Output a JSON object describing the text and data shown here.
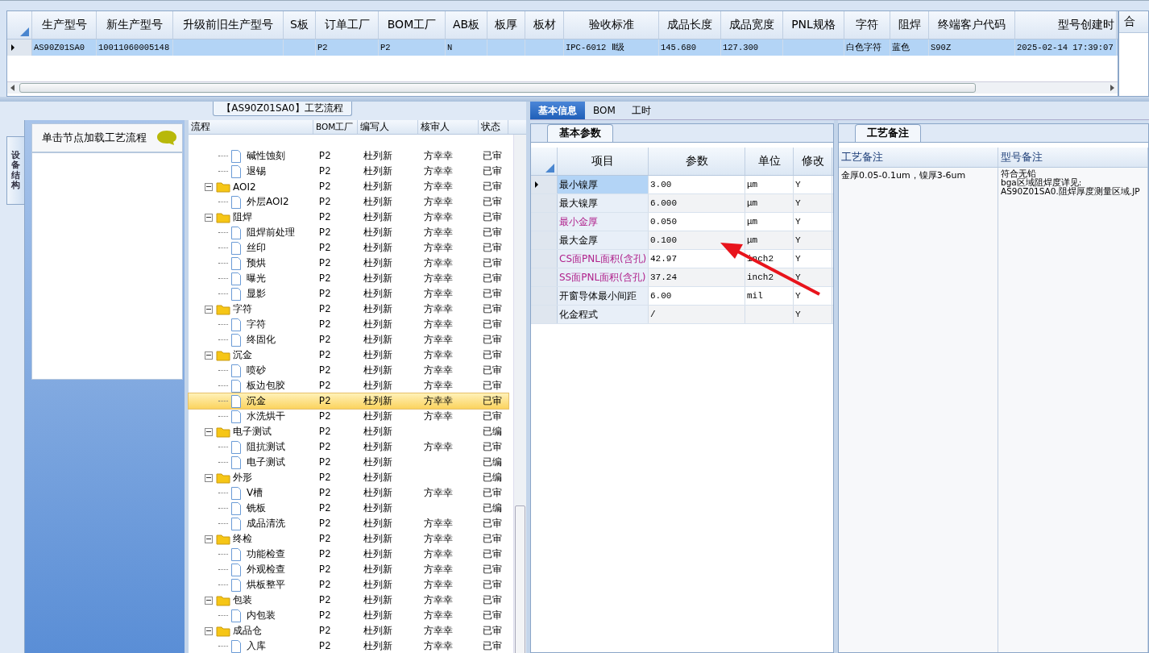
{
  "main_grid": {
    "columns": [
      "生产型号",
      "新生产型号",
      "升级前旧生产型号",
      "S板",
      "订单工厂",
      "BOM工厂",
      "AB板",
      "板厚",
      "板材",
      "验收标准",
      "成品长度",
      "成品宽度",
      "PNL规格",
      "字符",
      "阻焊",
      "终端客户代码",
      "型号创建时"
    ],
    "rows": [
      {
        "selected": true,
        "cells": [
          "AS90Z01SA0",
          "10011060005148",
          null,
          null,
          "P2",
          "P2",
          "N",
          null,
          null,
          "IPC-6012 Ⅱ级",
          "145.680",
          "127.300",
          null,
          "白色字符",
          "蓝色",
          "S90Z",
          "2025-02-14 17:39:07"
        ]
      }
    ]
  },
  "side_grid": {
    "columns": [
      "合"
    ]
  },
  "process_panel": {
    "title": "【AS90Z01SA0】工艺流程",
    "side_tab": "设备结构",
    "hint": "单击节点加载工艺流程",
    "tree": {
      "columns": [
        "流程",
        "BOM工厂",
        "编写人",
        "核审人",
        "状态"
      ],
      "nodes": [
        {
          "kind": "file",
          "label": "碱性蚀刻",
          "bom": "P2",
          "writer": "杜列新",
          "reviewer": "方幸幸",
          "status": "已审",
          "selected": false
        },
        {
          "kind": "file",
          "label": "退锡",
          "bom": "P2",
          "writer": "杜列新",
          "reviewer": "方幸幸",
          "status": "已审",
          "selected": false
        },
        {
          "kind": "folder",
          "label": "AOI2",
          "bom": "P2",
          "writer": "杜列新",
          "reviewer": "方幸幸",
          "status": "已审",
          "selected": false,
          "expanded": true,
          "children": [
            {
              "kind": "file",
              "label": "外层AOI2",
              "bom": "P2",
              "writer": "杜列新",
              "reviewer": "方幸幸",
              "status": "已审",
              "selected": false
            }
          ]
        },
        {
          "kind": "folder",
          "label": "阻焊",
          "bom": "P2",
          "writer": "杜列新",
          "reviewer": "方幸幸",
          "status": "已审",
          "selected": false,
          "expanded": true,
          "children": [
            {
              "kind": "file",
              "label": "阻焊前处理",
              "bom": "P2",
              "writer": "杜列新",
              "reviewer": "方幸幸",
              "status": "已审",
              "selected": false
            },
            {
              "kind": "file",
              "label": "丝印",
              "bom": "P2",
              "writer": "杜列新",
              "reviewer": "方幸幸",
              "status": "已审",
              "selected": false
            },
            {
              "kind": "file",
              "label": "预烘",
              "bom": "P2",
              "writer": "杜列新",
              "reviewer": "方幸幸",
              "status": "已审",
              "selected": false
            },
            {
              "kind": "file",
              "label": "曝光",
              "bom": "P2",
              "writer": "杜列新",
              "reviewer": "方幸幸",
              "status": "已审",
              "selected": false
            },
            {
              "kind": "file",
              "label": "显影",
              "bom": "P2",
              "writer": "杜列新",
              "reviewer": "方幸幸",
              "status": "已审",
              "selected": false
            }
          ]
        },
        {
          "kind": "folder",
          "label": "字符",
          "bom": "P2",
          "writer": "杜列新",
          "reviewer": "方幸幸",
          "status": "已审",
          "selected": false,
          "expanded": true,
          "children": [
            {
              "kind": "file",
              "label": "字符",
              "bom": "P2",
              "writer": "杜列新",
              "reviewer": "方幸幸",
              "status": "已审",
              "selected": false
            },
            {
              "kind": "file",
              "label": "终固化",
              "bom": "P2",
              "writer": "杜列新",
              "reviewer": "方幸幸",
              "status": "已审",
              "selected": false
            }
          ]
        },
        {
          "kind": "folder",
          "label": "沉金",
          "bom": "P2",
          "writer": "杜列新",
          "reviewer": "方幸幸",
          "status": "已审",
          "selected": false,
          "expanded": true,
          "children": [
            {
              "kind": "file",
              "label": "喷砂",
              "bom": "P2",
              "writer": "杜列新",
              "reviewer": "方幸幸",
              "status": "已审",
              "selected": false
            },
            {
              "kind": "file",
              "label": "板边包胶",
              "bom": "P2",
              "writer": "杜列新",
              "reviewer": "方幸幸",
              "status": "已审",
              "selected": false
            },
            {
              "kind": "file",
              "label": "沉金",
              "bom": "P2",
              "writer": "杜列新",
              "reviewer": "方幸幸",
              "status": "已审",
              "selected": true
            },
            {
              "kind": "file",
              "label": "水洗烘干",
              "bom": "P2",
              "writer": "杜列新",
              "reviewer": "方幸幸",
              "status": "已审",
              "selected": false
            }
          ]
        },
        {
          "kind": "folder",
          "label": "电子测试",
          "bom": "P2",
          "writer": "杜列新",
          "status": "已编",
          "selected": false,
          "expanded": true,
          "children": [
            {
              "kind": "file",
              "label": "阻抗测试",
              "bom": "P2",
              "writer": "杜列新",
              "reviewer": "方幸幸",
              "status": "已审",
              "selected": false
            },
            {
              "kind": "file",
              "label": "电子测试",
              "bom": "P2",
              "writer": "杜列新",
              "status": "已编",
              "selected": false
            }
          ]
        },
        {
          "kind": "folder",
          "label": "外形",
          "bom": "P2",
          "writer": "杜列新",
          "status": "已编",
          "selected": false,
          "expanded": true,
          "children": [
            {
              "kind": "file",
              "label": "V槽",
              "bom": "P2",
              "writer": "杜列新",
              "reviewer": "方幸幸",
              "status": "已审",
              "selected": false
            },
            {
              "kind": "file",
              "label": "铣板",
              "bom": "P2",
              "writer": "杜列新",
              "status": "已编",
              "selected": false
            },
            {
              "kind": "file",
              "label": "成品清洗",
              "bom": "P2",
              "writer": "杜列新",
              "reviewer": "方幸幸",
              "status": "已审",
              "selected": false
            }
          ]
        },
        {
          "kind": "folder",
          "label": "终检",
          "bom": "P2",
          "writer": "杜列新",
          "reviewer": "方幸幸",
          "status": "已审",
          "selected": false,
          "expanded": true,
          "children": [
            {
              "kind": "file",
              "label": "功能检查",
              "bom": "P2",
              "writer": "杜列新",
              "reviewer": "方幸幸",
              "status": "已审",
              "selected": false
            },
            {
              "kind": "file",
              "label": "外观检查",
              "bom": "P2",
              "writer": "杜列新",
              "reviewer": "方幸幸",
              "status": "已审",
              "selected": false
            },
            {
              "kind": "file",
              "label": "烘板整平",
              "bom": "P2",
              "writer": "杜列新",
              "reviewer": "方幸幸",
              "status": "已审",
              "selected": false
            }
          ]
        },
        {
          "kind": "folder",
          "label": "包装",
          "bom": "P2",
          "writer": "杜列新",
          "reviewer": "方幸幸",
          "status": "已审",
          "selected": false,
          "expanded": true,
          "children": [
            {
              "kind": "file",
              "label": "内包装",
              "bom": "P2",
              "writer": "杜列新",
              "reviewer": "方幸幸",
              "status": "已审",
              "selected": false
            }
          ]
        },
        {
          "kind": "folder",
          "label": "成品仓",
          "bom": "P2",
          "writer": "杜列新",
          "reviewer": "方幸幸",
          "status": "已审",
          "selected": false,
          "expanded": true,
          "children": [
            {
              "kind": "file",
              "label": "入库",
              "bom": "P2",
              "writer": "杜列新",
              "reviewer": "方幸幸",
              "status": "已审",
              "selected": false
            }
          ]
        }
      ]
    }
  },
  "detail_tabs": [
    {
      "label": "基本信息",
      "selected": true
    },
    {
      "label": "BOM",
      "selected": false
    },
    {
      "label": "工时",
      "selected": false
    }
  ],
  "params_panel": {
    "tab": "基本参数",
    "columns": [
      "项目",
      "参数",
      "单位",
      "修改"
    ],
    "rows": [
      {
        "item": "最小镍厚",
        "value": "3.00",
        "unit": "μm",
        "modified": "Y",
        "highlight": false,
        "selected": true
      },
      {
        "item": "最大镍厚",
        "value": "6.000",
        "unit": "μm",
        "modified": "Y",
        "highlight": false,
        "selected": false
      },
      {
        "item": "最小金厚",
        "value": "0.050",
        "unit": "μm",
        "modified": "Y",
        "highlight": true,
        "selected": false
      },
      {
        "item": "最大金厚",
        "value": "0.100",
        "unit": "μm",
        "modified": "Y",
        "highlight": false,
        "selected": false
      },
      {
        "item": "CS面PNL面积(含孔)",
        "value": "42.97",
        "unit": "inch2",
        "modified": "Y",
        "highlight": true,
        "selected": false
      },
      {
        "item": "SS面PNL面积(含孔)",
        "value": "37.24",
        "unit": "inch2",
        "modified": "Y",
        "highlight": true,
        "selected": false
      },
      {
        "item": "开窗导体最小间距",
        "value": "6.00",
        "unit": "mil",
        "modified": "Y",
        "highlight": false,
        "selected": false
      },
      {
        "item": "化金程式",
        "value": "/",
        "modified": "Y",
        "highlight": false,
        "selected": false
      }
    ]
  },
  "notes_panel": {
    "tab": "工艺备注",
    "columns": [
      "工艺备注",
      "型号备注"
    ],
    "process_note": "金厚0.05-0.1um，镍厚3-6um",
    "model_note": [
      "符合无铅",
      "bga区域阻焊度详见:",
      "AS90Z01SA0.阻焊厚度测量区域.JP"
    ]
  }
}
